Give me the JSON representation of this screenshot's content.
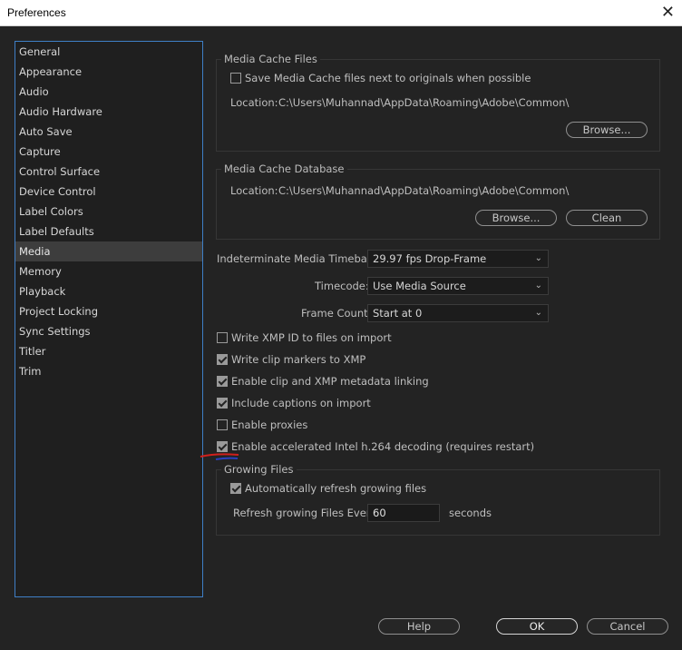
{
  "window": {
    "title": "Preferences",
    "close_glyph": "✕"
  },
  "sidebar": {
    "items": [
      {
        "label": "General"
      },
      {
        "label": "Appearance"
      },
      {
        "label": "Audio"
      },
      {
        "label": "Audio Hardware"
      },
      {
        "label": "Auto Save"
      },
      {
        "label": "Capture"
      },
      {
        "label": "Control Surface"
      },
      {
        "label": "Device Control"
      },
      {
        "label": "Label Colors"
      },
      {
        "label": "Label Defaults"
      },
      {
        "label": "Media"
      },
      {
        "label": "Memory"
      },
      {
        "label": "Playback"
      },
      {
        "label": "Project Locking"
      },
      {
        "label": "Sync Settings"
      },
      {
        "label": "Titler"
      },
      {
        "label": "Trim"
      }
    ],
    "selected": "Media"
  },
  "media_cache_files": {
    "title": "Media Cache Files",
    "save_next_to_originals": {
      "label": "Save Media Cache files next to originals when possible",
      "checked": false
    },
    "location_label": "Location:",
    "location_value": "C:\\Users\\Muhannad\\AppData\\Roaming\\Adobe\\Common\\",
    "browse_label": "Browse..."
  },
  "media_cache_database": {
    "title": "Media Cache Database",
    "location_label": "Location:",
    "location_value": "C:\\Users\\Muhannad\\AppData\\Roaming\\Adobe\\Common\\",
    "browse_label": "Browse...",
    "clean_label": "Clean"
  },
  "timebase": {
    "label": "Indeterminate Media Timebase:",
    "value": "29.97 fps Drop-Frame"
  },
  "timecode": {
    "label": "Timecode:",
    "value": "Use Media Source"
  },
  "frame_count": {
    "label": "Frame Count:",
    "value": "Start at 0"
  },
  "options": [
    {
      "label": "Write XMP ID to files on import",
      "checked": false
    },
    {
      "label": "Write clip markers to XMP",
      "checked": true
    },
    {
      "label": "Enable clip and XMP metadata linking",
      "checked": true
    },
    {
      "label": "Include captions on import",
      "checked": true
    },
    {
      "label": "Enable proxies",
      "checked": false
    },
    {
      "label": "Enable accelerated Intel h.264 decoding (requires restart)",
      "checked": true
    }
  ],
  "growing_files": {
    "title": "Growing Files",
    "auto_refresh": {
      "label": "Automatically refresh growing files",
      "checked": true
    },
    "refresh_label": "Refresh growing Files Every",
    "refresh_value": "60",
    "unit": "seconds"
  },
  "footer": {
    "help_label": "Help",
    "ok_label": "OK",
    "cancel_label": "Cancel"
  },
  "colors": {
    "accent": "#3f7fc6",
    "annotation_red": "#d0201c",
    "annotation_blue": "#2b3fbf"
  },
  "icons": {
    "checkbox": "checkbox-icon",
    "dropdown": "chevron-down-icon",
    "close": "close-icon"
  }
}
